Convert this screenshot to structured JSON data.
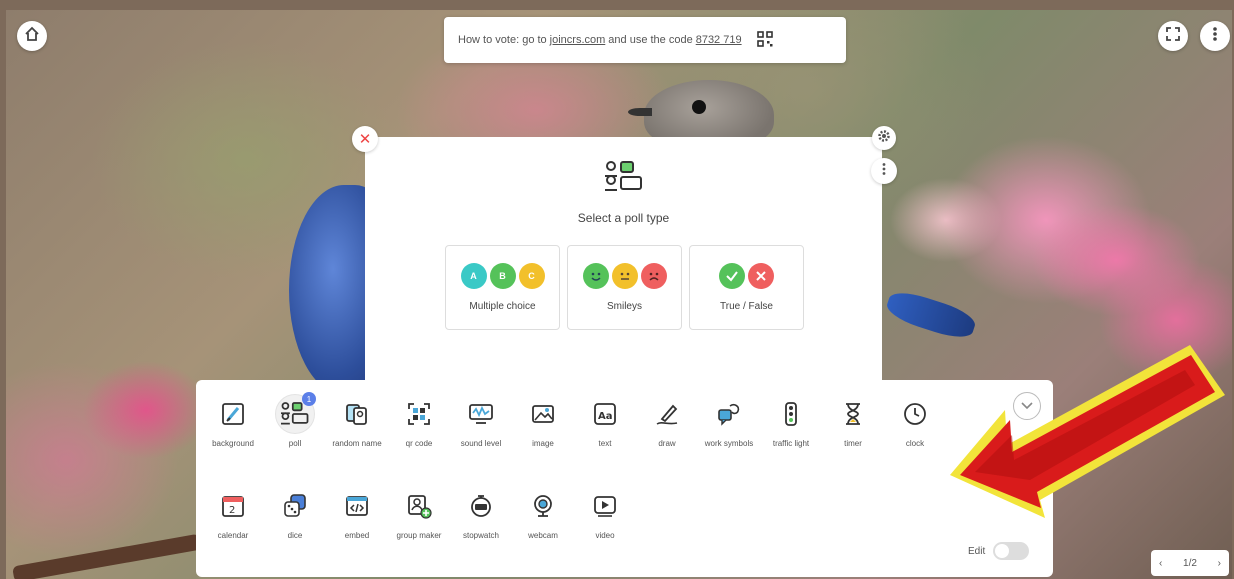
{
  "vote_bar": {
    "prefix": "How to vote: go to",
    "site": "joincrs.com",
    "middle": "and use the code",
    "code": "8732 719"
  },
  "poll_panel": {
    "title": "Select a poll type",
    "types": [
      {
        "label": "Multiple choice",
        "options": [
          "A",
          "B",
          "C"
        ]
      },
      {
        "label": "Smileys"
      },
      {
        "label": "True / False"
      }
    ]
  },
  "toolbar": {
    "tools": [
      {
        "label": "background"
      },
      {
        "label": "poll",
        "badge": "1"
      },
      {
        "label": "random name"
      },
      {
        "label": "qr code"
      },
      {
        "label": "sound level"
      },
      {
        "label": "image"
      },
      {
        "label": "text"
      },
      {
        "label": "draw"
      },
      {
        "label": "work symbols"
      },
      {
        "label": "traffic light"
      },
      {
        "label": "timer"
      },
      {
        "label": "clock"
      },
      {
        "label": "calendar"
      },
      {
        "label": "dice"
      },
      {
        "label": "embed"
      },
      {
        "label": "group maker"
      },
      {
        "label": "stopwatch"
      },
      {
        "label": "webcam"
      },
      {
        "label": "video"
      }
    ],
    "edit_label": "Edit",
    "calendar_day": "2"
  },
  "pager": {
    "text": "1/2"
  },
  "colors": {
    "teal": "#3ac9c6",
    "green": "#55c25a",
    "yellow": "#f2c02b",
    "red": "#ef5f5f",
    "accent": "#5b7fe8",
    "arrow": "#d91b1b"
  }
}
